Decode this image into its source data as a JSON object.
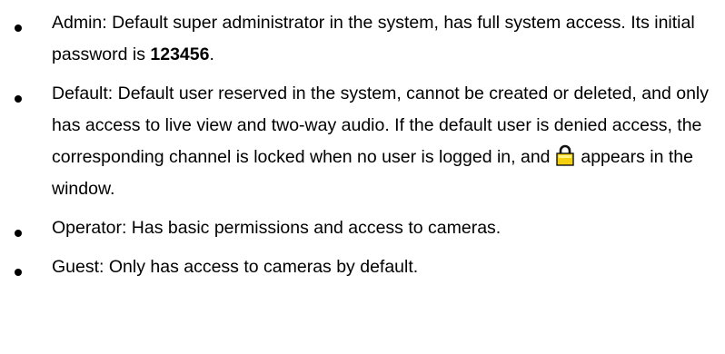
{
  "items": [
    {
      "text_before_bold": "Admin: Default super administrator in the system, has full system access. Its initial password is ",
      "bold": "123456",
      "text_after_bold": "."
    },
    {
      "text_before_icon": "Default: Default user reserved in the system, cannot be created or deleted, and only has access to live view and two-way audio. If the default user is denied access, the corresponding channel is locked when no user is logged in, and ",
      "icon": "lock-icon",
      "text_after_icon": " appears in the window."
    },
    {
      "text": "Operator: Has basic permissions and access to cameras."
    },
    {
      "text": "Guest: Only has access to cameras by default."
    }
  ],
  "colors": {
    "lock_body": "#f5d010",
    "lock_shackle": "#111111"
  }
}
